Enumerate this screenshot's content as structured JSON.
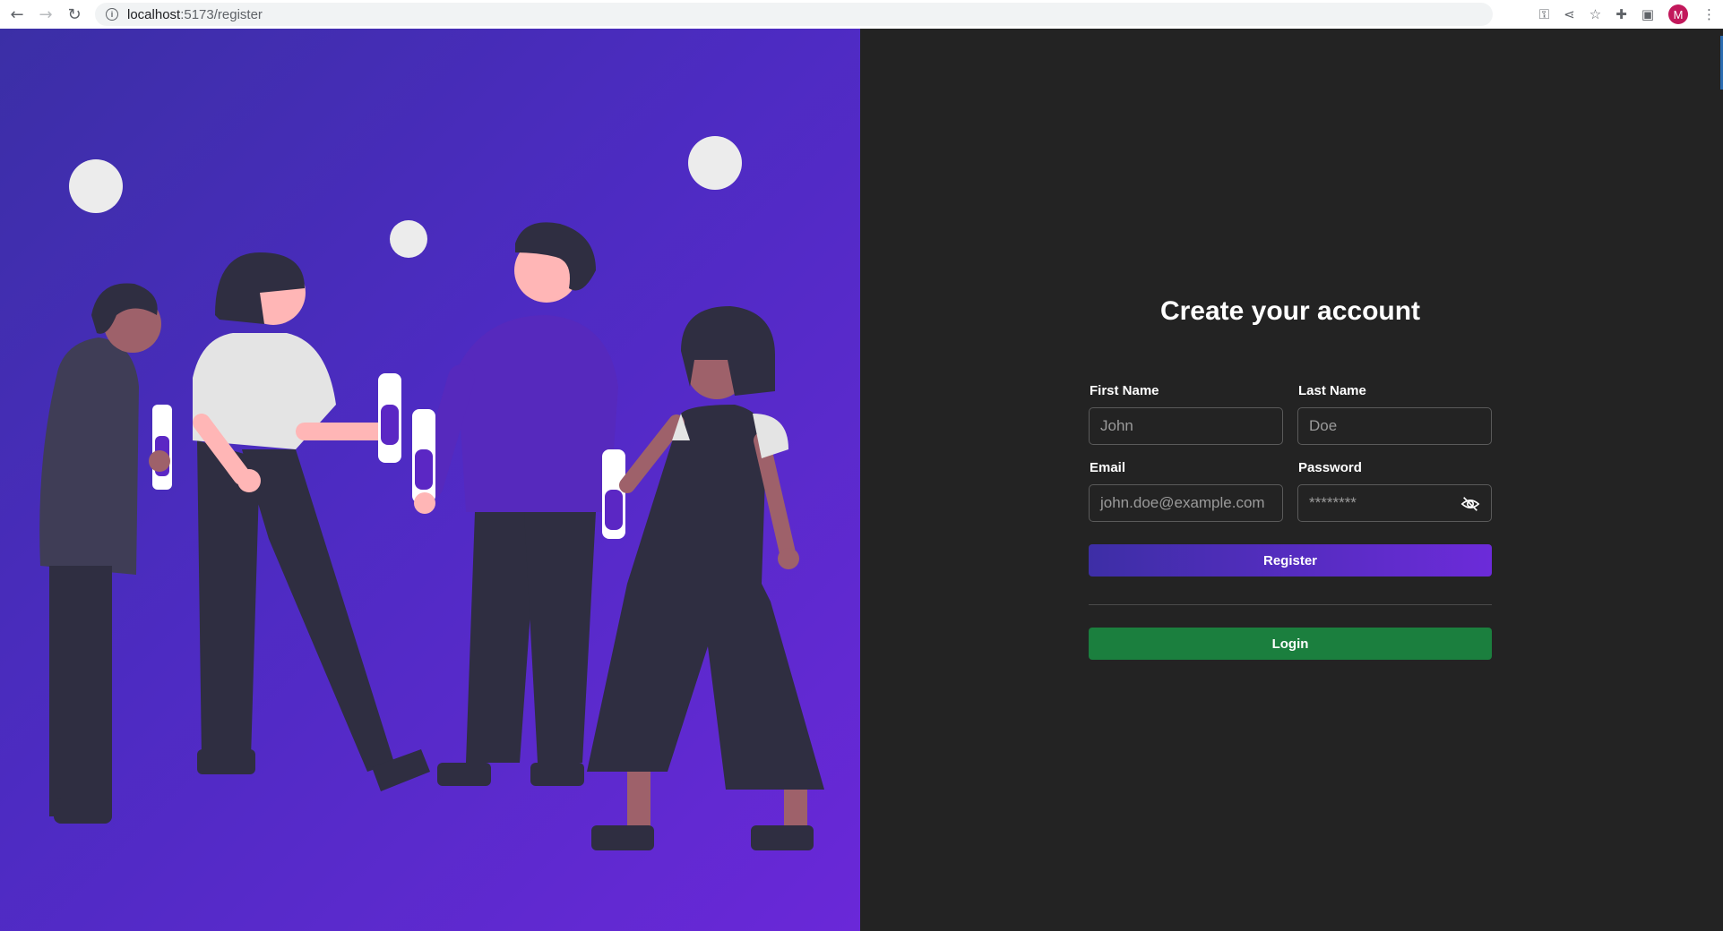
{
  "browser": {
    "url_host": "localhost",
    "url_path": ":5173/register",
    "profile_initial": "M"
  },
  "form": {
    "title": "Create your account",
    "first_name": {
      "label": "First Name",
      "placeholder": "John"
    },
    "last_name": {
      "label": "Last Name",
      "placeholder": "Doe"
    },
    "email": {
      "label": "Email",
      "placeholder": "john.doe@example.com"
    },
    "password": {
      "label": "Password",
      "placeholder": "********"
    },
    "register_label": "Register",
    "login_label": "Login"
  },
  "colors": {
    "background_dark": "#232323",
    "hero_gradient_start": "#3b2fa6",
    "hero_gradient_end": "#6a28d8",
    "register_button": "#4d2bc2",
    "login_button": "#1b7f3e"
  },
  "icons": {
    "back": "arrow-left-icon",
    "forward": "arrow-right-icon",
    "reload": "reload-icon",
    "password_toggle": "eye-slash-icon"
  }
}
